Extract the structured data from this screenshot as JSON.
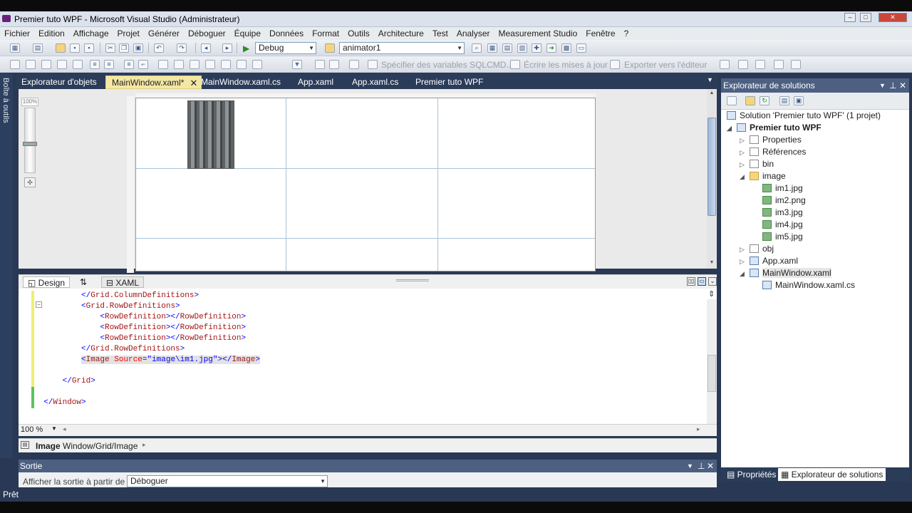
{
  "window": {
    "title": "Premier tuto WPF - Microsoft Visual Studio (Administrateur)",
    "controls": [
      "–",
      "□",
      "✕"
    ]
  },
  "menu": [
    "Fichier",
    "Edition",
    "Affichage",
    "Projet",
    "Générer",
    "Déboguer",
    "Équipe",
    "Données",
    "Format",
    "Outils",
    "Architecture",
    "Test",
    "Analyser",
    "Measurement Studio",
    "Fenêtre",
    "?"
  ],
  "toolbar": {
    "config": "Debug",
    "target": "animator1",
    "sqlcmd": "Spécifier des variables SQLCMD...",
    "write_updates": "Écrire les mises à jour",
    "export_editor": "Exporter vers l'éditeur"
  },
  "toolbox": {
    "label": "Boîte à outils"
  },
  "tabs": [
    {
      "label": "Explorateur d'objets",
      "active": false
    },
    {
      "label": "MainWindow.xaml*",
      "active": true
    },
    {
      "label": "MainWindow.xaml.cs",
      "active": false
    },
    {
      "label": "App.xaml",
      "active": false
    },
    {
      "label": "App.xaml.cs",
      "active": false
    },
    {
      "label": "Premier tuto WPF",
      "active": false
    }
  ],
  "designer": {
    "zoom_label": "100%"
  },
  "view_tabs": {
    "design": "Design",
    "swap": "⇅",
    "xaml": "XAML"
  },
  "code_zoom": "100 %",
  "breadcrumb": {
    "element": "Image",
    "path": "Window/Grid/Image"
  },
  "output": {
    "title": "Sortie",
    "source_label": "Afficher la sortie à partir de :",
    "source_value": "Déboguer"
  },
  "solution_explorer": {
    "title": "Explorateur de solutions",
    "solution": "Solution 'Premier tuto WPF' (1 projet)",
    "project": "Premier tuto WPF",
    "items": [
      {
        "label": "Properties"
      },
      {
        "label": "Références"
      },
      {
        "label": "bin"
      },
      {
        "label": "image"
      },
      {
        "label": "im1.jpg"
      },
      {
        "label": "im2.png"
      },
      {
        "label": "im3.jpg"
      },
      {
        "label": "im4.jpg"
      },
      {
        "label": "im5.jpg"
      },
      {
        "label": "obj"
      },
      {
        "label": "App.xaml"
      },
      {
        "label": "MainWindow.xaml"
      },
      {
        "label": "MainWindow.xaml.cs"
      }
    ]
  },
  "bottom_tabs": {
    "properties": "Propriétés",
    "solution": "Explorateur de solutions"
  },
  "status": "Prêt",
  "colors": {
    "active_tab": "#f3e7a6",
    "frame": "#293955",
    "panel_header": "#4d6082"
  }
}
